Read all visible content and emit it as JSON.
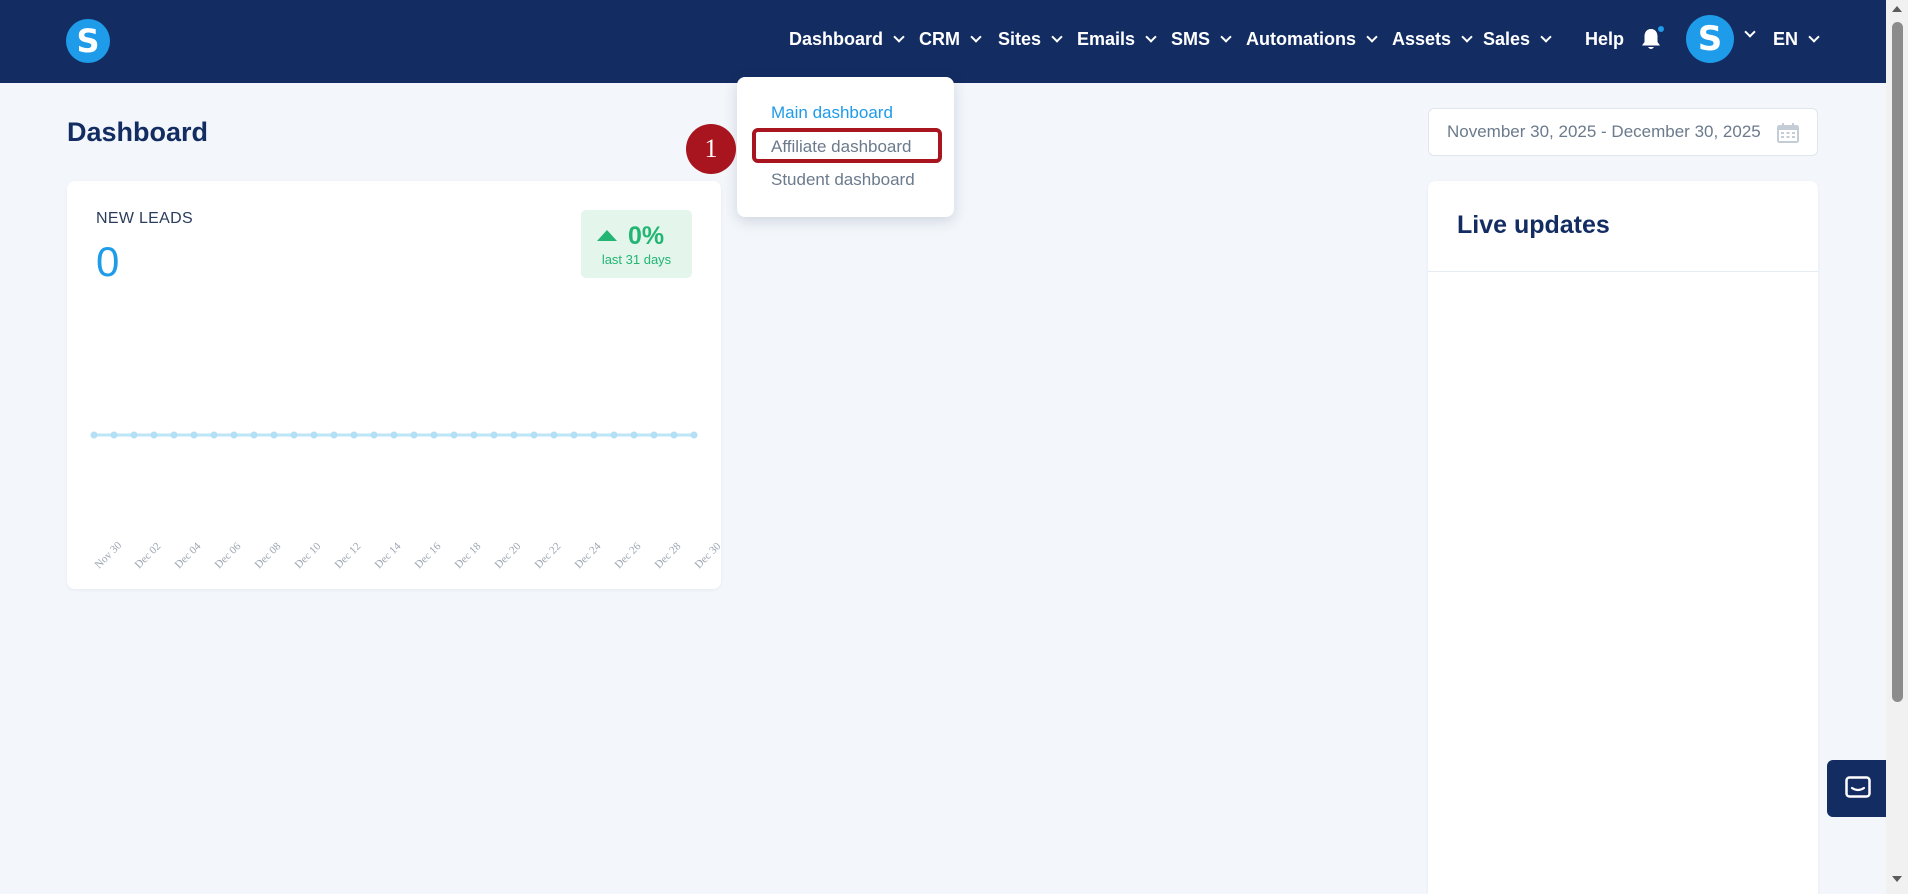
{
  "header": {
    "logo_letter": "S",
    "nav": [
      {
        "label": "Dashboard"
      },
      {
        "label": "CRM"
      },
      {
        "label": "Sites"
      },
      {
        "label": "Emails"
      },
      {
        "label": "SMS"
      },
      {
        "label": "Automations"
      },
      {
        "label": "Assets"
      },
      {
        "label": "Sales"
      }
    ],
    "help_label": "Help",
    "avatar_letter": "S",
    "language": "EN",
    "notification_icon": "bell-icon",
    "notification_dot_color": "#1e9be9"
  },
  "dashboard_menu": {
    "items": [
      {
        "label": "Main dashboard"
      },
      {
        "label": "Affiliate dashboard"
      },
      {
        "label": "Student dashboard"
      }
    ],
    "step_marker": "1"
  },
  "page": {
    "title": "Dashboard",
    "date_range": "November 30, 2025 - December 30, 2025",
    "calendar_icon": "calendar-icon"
  },
  "new_leads": {
    "label": "NEW LEADS",
    "value": "0",
    "trend_percent": "0%",
    "trend_period": "last 31 days",
    "trend_direction": "up"
  },
  "live_updates": {
    "title": "Live updates"
  },
  "chat": {
    "icon": "chat-icon"
  },
  "colors": {
    "nav_bg": "#132d63",
    "accent": "#1e9be9",
    "trend_green": "#22b573",
    "highlight_red": "#a8151e"
  },
  "chart_data": {
    "type": "line",
    "x": [
      "Nov 30",
      "Dec 01",
      "Dec 02",
      "Dec 03",
      "Dec 04",
      "Dec 05",
      "Dec 06",
      "Dec 07",
      "Dec 08",
      "Dec 09",
      "Dec 10",
      "Dec 11",
      "Dec 12",
      "Dec 13",
      "Dec 14",
      "Dec 15",
      "Dec 16",
      "Dec 17",
      "Dec 18",
      "Dec 19",
      "Dec 20",
      "Dec 21",
      "Dec 22",
      "Dec 23",
      "Dec 24",
      "Dec 25",
      "Dec 26",
      "Dec 27",
      "Dec 28",
      "Dec 29",
      "Dec 30"
    ],
    "tick_labels": [
      "Nov 30",
      "Dec 02",
      "Dec 04",
      "Dec 06",
      "Dec 08",
      "Dec 10",
      "Dec 12",
      "Dec 14",
      "Dec 16",
      "Dec 18",
      "Dec 20",
      "Dec 22",
      "Dec 24",
      "Dec 26",
      "Dec 28",
      "Dec 30"
    ],
    "series": [
      {
        "values": [
          0,
          0,
          0,
          0,
          0,
          0,
          0,
          0,
          0,
          0,
          0,
          0,
          0,
          0,
          0,
          0,
          0,
          0,
          0,
          0,
          0,
          0,
          0,
          0,
          0,
          0,
          0,
          0,
          0,
          0,
          0
        ]
      }
    ],
    "title": "",
    "xlabel": "",
    "ylabel": "",
    "grid": false,
    "line_color": "#bfe6f7"
  }
}
